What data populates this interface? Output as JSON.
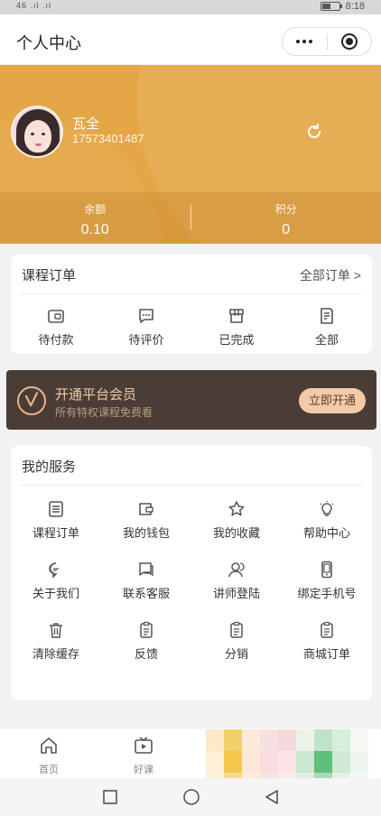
{
  "status_bar": {
    "signal": "46 .ıl .ıl",
    "time": "8:18"
  },
  "header": {
    "title": "个人中心"
  },
  "profile": {
    "name": "瓦全",
    "phone": "17573401487"
  },
  "stats": [
    {
      "label": "余额",
      "value": "0.10"
    },
    {
      "label": "积分",
      "value": "0"
    }
  ],
  "orders": {
    "title": "课程订单",
    "more": "全部订单 >",
    "items": [
      {
        "label": "待付款",
        "icon": "wallet-icon"
      },
      {
        "label": "待评价",
        "icon": "comment-icon"
      },
      {
        "label": "已完成",
        "icon": "box-icon"
      },
      {
        "label": "全部",
        "icon": "list-icon"
      }
    ]
  },
  "vip": {
    "title": "开通平台会员",
    "subtitle": "所有特权课程免费看",
    "button": "立即开通"
  },
  "services": {
    "title": "我的服务",
    "items": [
      {
        "label": "课程订单",
        "icon": "order-icon"
      },
      {
        "label": "我的钱包",
        "icon": "wallet-icon"
      },
      {
        "label": "我的收藏",
        "icon": "star-icon"
      },
      {
        "label": "帮助中心",
        "icon": "lightbulb-icon"
      },
      {
        "label": "关于我们",
        "icon": "chat-bubble-icon"
      },
      {
        "label": "联系客服",
        "icon": "customer-service-icon"
      },
      {
        "label": "讲师登陆",
        "icon": "lecturer-icon"
      },
      {
        "label": "绑定手机号",
        "icon": "phone-icon"
      },
      {
        "label": "清除缓存",
        "icon": "trash-icon"
      },
      {
        "label": "反馈",
        "icon": "clipboard-icon"
      },
      {
        "label": "分销",
        "icon": "clipboard-icon"
      },
      {
        "label": "商城订单",
        "icon": "clipboard-icon"
      }
    ]
  },
  "tabbar": [
    {
      "label": "首页",
      "icon": "home-icon"
    },
    {
      "label": "好课",
      "icon": "tv-icon"
    }
  ],
  "colors": {
    "banner": "#e5a646",
    "vip_bg": "#4a3d35",
    "vip_accent": "#f3c9a8"
  }
}
